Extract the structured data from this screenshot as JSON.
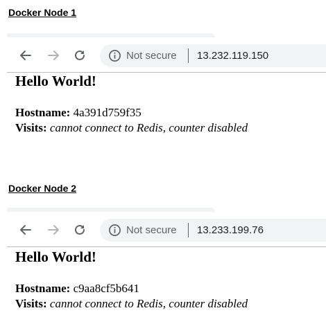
{
  "nodes": [
    {
      "heading": "Docker Node 1",
      "browser": {
        "security_label": "Not secure",
        "url": "13.232.119.150"
      },
      "page": {
        "title": "Hello World!",
        "hostname_label": "Hostname:",
        "hostname_value": "4a391d759f35",
        "visits_label": "Visits:",
        "visits_value": "cannot connect to Redis, counter disabled"
      }
    },
    {
      "heading": "Docker Node 2",
      "browser": {
        "security_label": "Not secure",
        "url": "13.233.199.76"
      },
      "page": {
        "title": "Hello World!",
        "hostname_label": "Hostname:",
        "hostname_value": "c9aa8cf5b641",
        "visits_label": "Visits:",
        "visits_value": "cannot connect to Redis, counter disabled"
      }
    }
  ],
  "icons": {
    "back": "back-arrow-icon",
    "forward": "forward-arrow-icon",
    "reload": "reload-icon",
    "info": "info-icon"
  },
  "colors": {
    "toolbar_icon": "#5f6368",
    "forward_disabled": "#b0b4b8",
    "omnibox_bg": "#f1f3f4",
    "text": "#000000"
  }
}
